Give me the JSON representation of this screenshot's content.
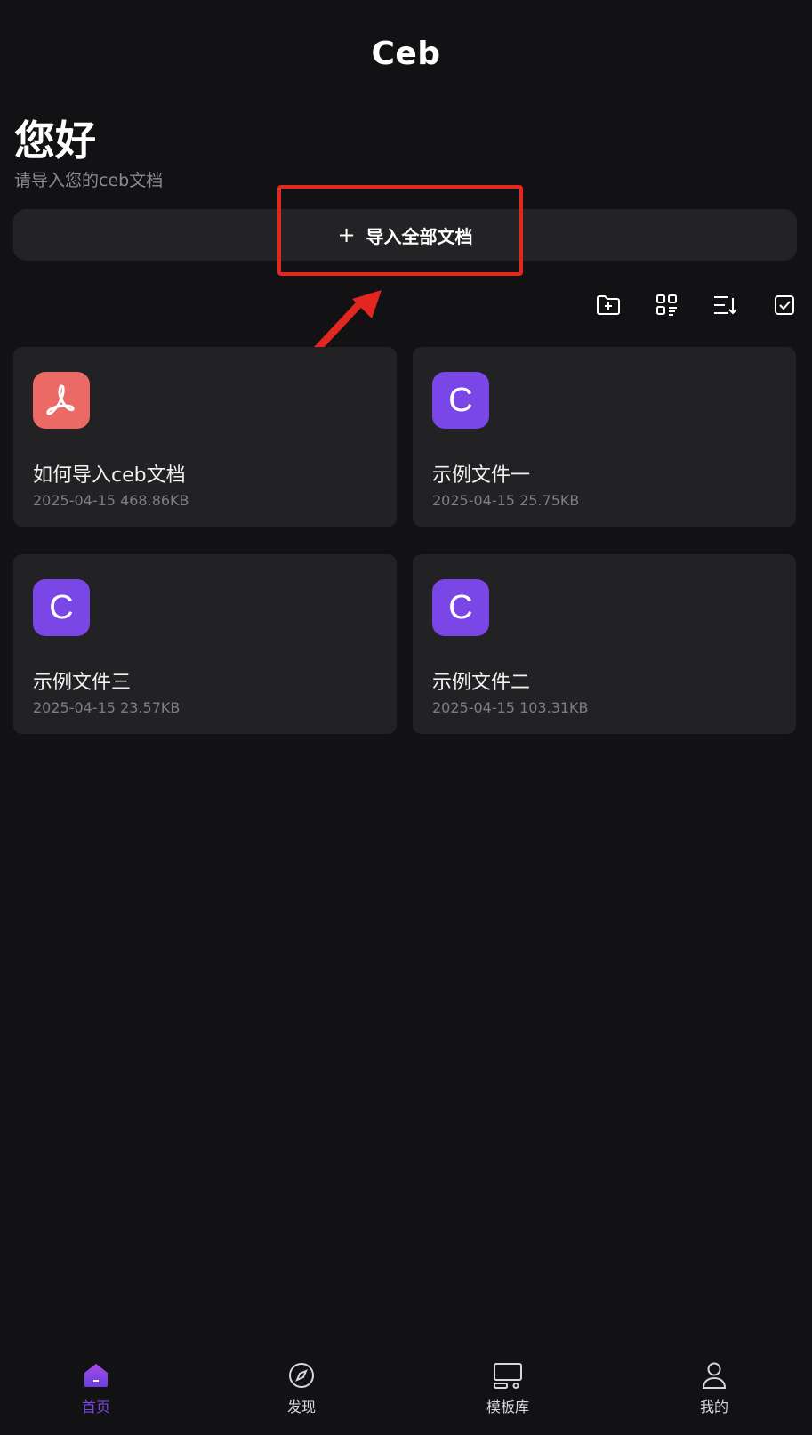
{
  "header": {
    "title": "Ceb"
  },
  "greeting": {
    "title": "您好",
    "subtitle": "请导入您的ceb文档"
  },
  "import_button": {
    "icon": "plus-icon",
    "label": "导入全部文档"
  },
  "toolbar": {
    "icons": [
      "new-folder-icon",
      "grid-view-icon",
      "sort-icon",
      "select-icon"
    ]
  },
  "files": [
    {
      "name": "如何导入ceb文档",
      "date": "2025-04-15",
      "size": "468.86KB",
      "meta": "2025-04-15 468.86KB",
      "icon": "pdf-icon",
      "color": "#ec6a66"
    },
    {
      "name": "示例文件一",
      "date": "2025-04-15",
      "size": "25.75KB",
      "meta": "2025-04-15 25.75KB",
      "icon": "ceb-icon",
      "letter": "C",
      "color": "#7a47e6"
    },
    {
      "name": "示例文件三",
      "date": "2025-04-15",
      "size": "23.57KB",
      "meta": "2025-04-15 23.57KB",
      "icon": "ceb-icon",
      "letter": "C",
      "color": "#7a47e6"
    },
    {
      "name": "示例文件二",
      "date": "2025-04-15",
      "size": "103.31KB",
      "meta": "2025-04-15 103.31KB",
      "icon": "ceb-icon",
      "letter": "C",
      "color": "#7a47e6"
    }
  ],
  "bottom_nav": [
    {
      "label": "首页",
      "icon": "home-icon",
      "active": true
    },
    {
      "label": "发现",
      "icon": "compass-icon",
      "active": false
    },
    {
      "label": "模板库",
      "icon": "template-icon",
      "active": false
    },
    {
      "label": "我的",
      "icon": "profile-icon",
      "active": false
    }
  ],
  "colors": {
    "background": "#121113",
    "card": "#222124",
    "accent": "#7a47e6",
    "pdf": "#ec6a66",
    "annotation": "#e3261f"
  }
}
